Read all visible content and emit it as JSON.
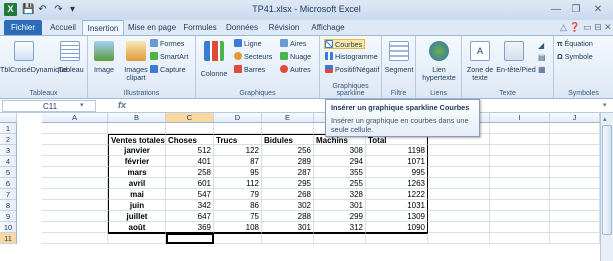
{
  "window": {
    "title": "TP41.xlsx - Microsoft Excel",
    "qat": [
      "💾",
      "↶",
      "↷",
      "▾"
    ],
    "controls": [
      "—",
      "❐",
      "✕"
    ]
  },
  "tabs": [
    "Fichier",
    "Accueil",
    "Insertion",
    "Mise en page",
    "Formules",
    "Données",
    "Révision",
    "Affichage"
  ],
  "ribbon": {
    "tableaux": {
      "label": "Tableaux",
      "tcd": "TblCroiséDynamique",
      "tableau": "Tableau"
    },
    "illustrations": {
      "label": "Illustrations",
      "image": "Image",
      "images": "Images clipart",
      "formes": "Formes",
      "smartart": "SmartArt",
      "capture": "Capture"
    },
    "graphiques": {
      "label": "Graphiques",
      "colonne": "Colonne",
      "ligne": "Ligne",
      "secteurs": "Secteurs",
      "barres": "Barres",
      "aires": "Aires",
      "nuage": "Nuage",
      "autres": "Autres"
    },
    "sparkline": {
      "label": "Graphiques sparkline",
      "courbes": "Courbes",
      "histogramme": "Histogramme",
      "positif": "Positif/Négatif"
    },
    "filtre": {
      "label": "Filtre",
      "segment": "Segment"
    },
    "liens": {
      "label": "Liens",
      "lien": "Lien hypertexte"
    },
    "texte": {
      "label": "Texte",
      "zone": "Zone de texte",
      "entete": "En-tête/Pied"
    },
    "symboles": {
      "label": "Symboles",
      "equation": "Équation",
      "symbole": "Symbole"
    }
  },
  "formula": {
    "cell": "C11",
    "fx": "fx",
    "value": ""
  },
  "tooltip": {
    "title": "Insérer un graphique sparkline Courbes",
    "body": "Insérer un graphique en courbes dans une seule cellule."
  },
  "columns": [
    "A",
    "B",
    "C",
    "D",
    "E",
    "F",
    "G",
    "H",
    "I",
    "J"
  ],
  "rows": [
    "1",
    "2",
    "3",
    "4",
    "5",
    "6",
    "7",
    "8",
    "9",
    "10",
    "11"
  ],
  "table": {
    "headers": [
      "Ventes totales",
      "Choses",
      "Trucs",
      "Bidules",
      "Machins",
      "Total"
    ],
    "data": [
      [
        "janvier",
        "512",
        "122",
        "256",
        "308",
        "1198"
      ],
      [
        "février",
        "401",
        "87",
        "289",
        "294",
        "1071"
      ],
      [
        "mars",
        "258",
        "95",
        "287",
        "355",
        "995"
      ],
      [
        "avril",
        "601",
        "112",
        "295",
        "255",
        "1263"
      ],
      [
        "mai",
        "547",
        "79",
        "268",
        "328",
        "1222"
      ],
      [
        "juin",
        "342",
        "86",
        "302",
        "301",
        "1031"
      ],
      [
        "juillet",
        "647",
        "75",
        "288",
        "299",
        "1309"
      ],
      [
        "août",
        "369",
        "108",
        "301",
        "312",
        "1090"
      ]
    ]
  },
  "colors": {
    "accent": "#2b6cb8",
    "selection": "#f9d99f",
    "highlight": "#fbe9a3"
  }
}
